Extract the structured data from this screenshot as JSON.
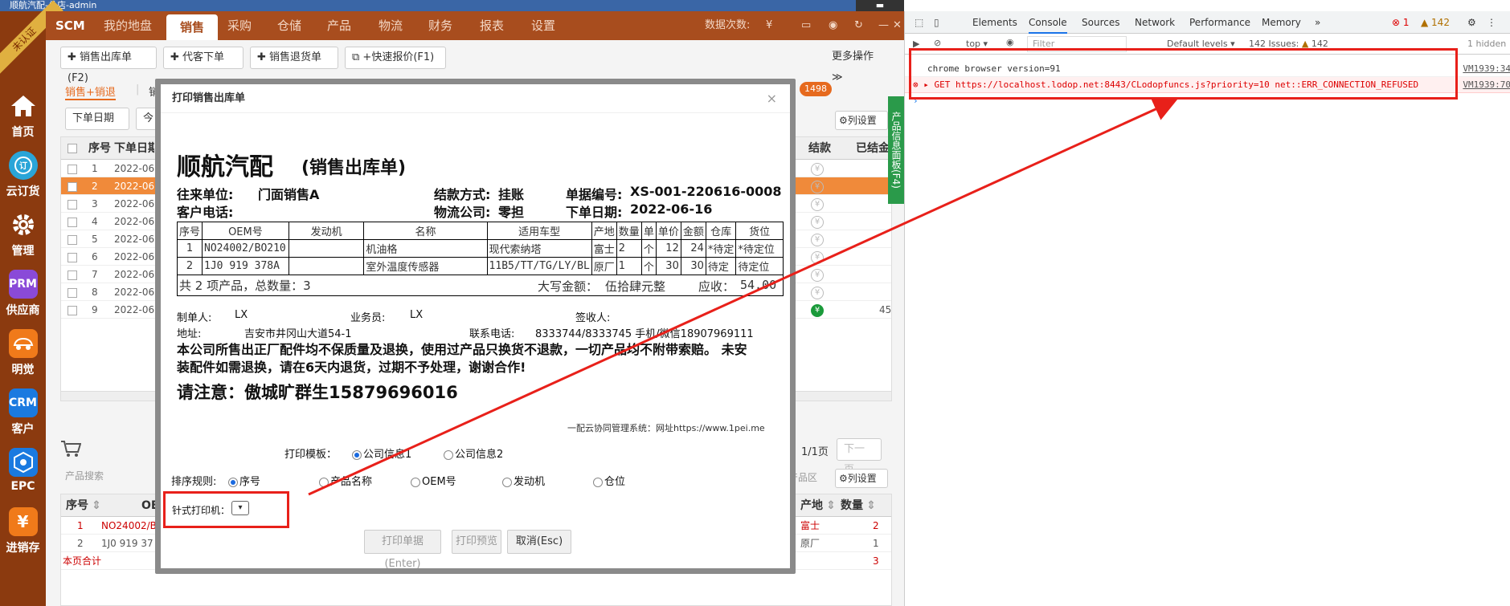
{
  "window": {
    "title": "顺航汽配-总店-admin"
  },
  "cert_label": "未认证",
  "sidebar": [
    {
      "label": "首页",
      "icon": "home-icon",
      "color": "#8b3a0f"
    },
    {
      "label": "云订货",
      "icon": "cloud-order-icon",
      "color": "#2aa5d8"
    },
    {
      "label": "管理",
      "icon": "gear-icon",
      "color": "#8b3a0f"
    },
    {
      "label": "供应商",
      "icon": "PRM",
      "color": "#8a4ad8"
    },
    {
      "label": "明觉",
      "icon": "car-icon",
      "color": "#f07a1a"
    },
    {
      "label": "客户",
      "icon": "CRM",
      "color": "#1a7ae0"
    },
    {
      "label": "EPC",
      "icon": "network-icon",
      "color": "#1a7ae0"
    },
    {
      "label": "进销存",
      "icon": "¥",
      "color": "#f07a1a"
    }
  ],
  "topnav": {
    "logo": "SCM",
    "items": [
      "我的地盘",
      "销售",
      "采购",
      "仓储",
      "产品",
      "物流",
      "财务",
      "报表",
      "设置"
    ],
    "active": "销售",
    "right": {
      "count_label": "数据次数:",
      "count_value": "¥"
    }
  },
  "toolbar": {
    "b1": "销售出库单(F2)",
    "b2": "代客下单",
    "b3": "销售退货单",
    "b4": "+快速报价(F1)",
    "more": "更多操作"
  },
  "subtabs": {
    "t1": "销售+销退",
    "t2": "销",
    "badge": "1498"
  },
  "filter": {
    "select": "下单日期",
    "today": "今",
    "col_settings": "列设置"
  },
  "grid": {
    "headers": {
      "seq": "序号",
      "date": "下单日期",
      "settle": "结款",
      "settled": "已结金"
    },
    "rows": [
      {
        "n": "1",
        "d": "2022-06-1"
      },
      {
        "n": "2",
        "d": "2022-06-1"
      },
      {
        "n": "3",
        "d": "2022-06-1"
      },
      {
        "n": "4",
        "d": "2022-06-1"
      },
      {
        "n": "5",
        "d": "2022-06-1"
      },
      {
        "n": "6",
        "d": "2022-06-1"
      },
      {
        "n": "7",
        "d": "2022-06-1"
      },
      {
        "n": "8",
        "d": "2022-06-1"
      },
      {
        "n": "9",
        "d": "2022-06-1"
      }
    ],
    "last_settled": "45"
  },
  "pager": {
    "text": "1/1页",
    "next": "下一页"
  },
  "bottom": {
    "search_placeholder": "产品搜索",
    "area": "产品区",
    "col_settings": "列设置",
    "headers": {
      "seq": "序号",
      "oem": "OEM",
      "origin": "产地",
      "qty": "数量"
    },
    "rows": [
      {
        "n": "1",
        "oem": "NO24002/B",
        "origin": "富士",
        "qty": "2"
      },
      {
        "n": "2",
        "oem": "1J0 919 37",
        "origin": "原厂",
        "qty": "1"
      }
    ],
    "total_label": "本页合计",
    "total": "3"
  },
  "sidepanel": "产品信息面板(F4)",
  "dialog": {
    "title": "打印销售出库单",
    "company": "顺航汽配",
    "doctype": "(销售出库单)",
    "partner_label": "往来单位:",
    "partner": "门面销售A",
    "settle_label": "结款方式:",
    "settle": "挂账",
    "no_label": "单据编号:",
    "no": "XS-001-220616-0008",
    "phone_label": "客户电话:",
    "logistics_label": "物流公司:",
    "logistics": "零担",
    "date_label": "下单日期:",
    "date": "2022-06-16",
    "table": {
      "headers": [
        "序号",
        "OEM号",
        "发动机",
        "名称",
        "适用车型",
        "产地",
        "数量",
        "单",
        "单价",
        "金额",
        "仓库",
        "货位"
      ],
      "rows": [
        [
          "1",
          "NO24002/BO210",
          "",
          "机油格",
          "现代索纳塔",
          "富士",
          "2",
          "个",
          "12",
          "24",
          "*待定",
          "*待定位"
        ],
        [
          "2",
          "1J0 919 378A",
          "",
          "室外温度传感器",
          "11B5/TT/TG/LY/BL",
          "原厂",
          "1",
          "个",
          "30",
          "30",
          "待定",
          "待定位"
        ]
      ],
      "summary": "共 2 项产品，总数量：3",
      "amount_label": "大写金额：",
      "amount": "伍拾肆元整",
      "due_label": "应收：",
      "due": "54.00"
    },
    "maker_label": "制单人:",
    "maker": "LX",
    "sales_label": "业务员:",
    "sales": "LX",
    "sign_label": "签收人:",
    "addr_label": "地址:",
    "addr": "吉安市井冈山大道54-1",
    "contact_label": "联系电话:",
    "contact": "8333744/8333745 手机/微信18907969111",
    "notice": "本公司所售出正厂配件均不保质量及退换，使用过产品只换货不退款，一切产品均不附带索赔。 未安装配件如需退换，请在6天内退货，过期不予处理，谢谢合作!",
    "attention": "请注意：傲城旷群生15879696016",
    "footer": "一配云协同管理系统：网址https://www.1pei.me",
    "template_label": "打印模板：",
    "template_opts": [
      "公司信息1",
      "公司信息2"
    ],
    "sort_label": "排序规则:",
    "sort_opts": [
      "序号",
      "产品名称",
      "OEM号",
      "发动机",
      "仓位"
    ],
    "printer_label": "针式打印机：",
    "btn_print": "打印单据(Enter)",
    "btn_preview": "打印预览",
    "btn_cancel": "取消(Esc)"
  },
  "devtools": {
    "tabs": [
      "Elements",
      "Console",
      "Sources",
      "Network",
      "Performance",
      "Memory",
      "»"
    ],
    "active": "Console",
    "errors": "1",
    "warnings": "142",
    "bar": {
      "top": "top",
      "filter": "Filter",
      "levels": "Default levels ▾",
      "issues": "142 Issues:",
      "issues_count": "142",
      "hidden": "1 hidden"
    },
    "lines": [
      {
        "text": "chrome browser version=91",
        "src": "VM1939:34"
      },
      {
        "text": "GET https://localhost.lodop.net:8443/CLodopfuncs.js?priority=10 net::ERR_CONNECTION_REFUSED",
        "src": "VM1939:70"
      }
    ],
    "prompt": "›"
  },
  "colors": {
    "brand": "#a84d1e",
    "accent": "#f08a3a",
    "annotation": "#e8201a"
  }
}
